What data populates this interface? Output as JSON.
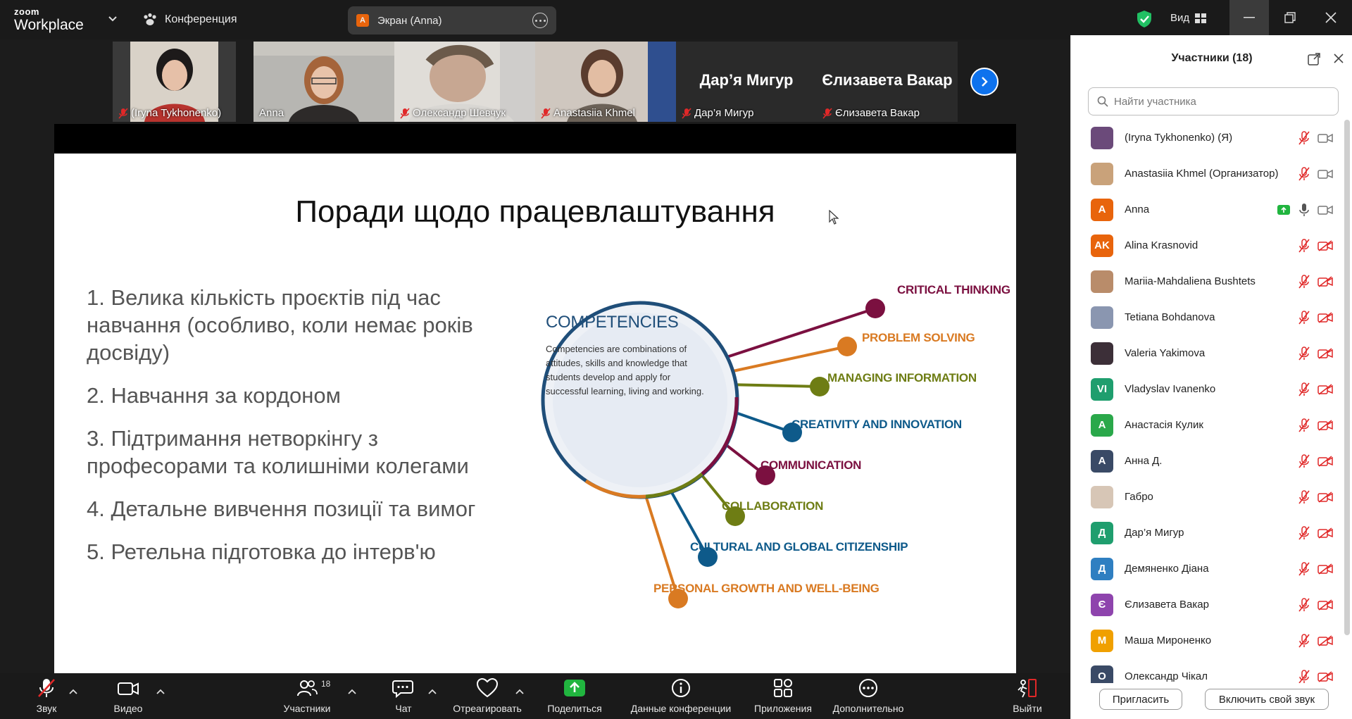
{
  "window": {
    "app_brand_top": "zoom",
    "app_brand_bottom": "Workplace",
    "conference_label": "Конференция",
    "screen_share_label": "Экран (Anna)",
    "screen_share_badge": "A",
    "view_label": "Вид"
  },
  "gallery": {
    "tiles": [
      {
        "name": "(Iryna Tykhonenko)",
        "muted": true
      },
      {
        "name": "Anna",
        "muted": false,
        "active": true
      },
      {
        "name": "Олександр Шевчук",
        "muted": true
      },
      {
        "name": "Anastasiia Khmel",
        "muted": true
      },
      {
        "name": "Дар’я Мигур",
        "muted": true,
        "big_name": "Дар’я Мигур"
      },
      {
        "name": "Єлизавета Вакар",
        "muted": true,
        "big_name": "Єлизавета Вакар"
      }
    ]
  },
  "slide": {
    "title": "Поради щодо працевлаштування",
    "tips": [
      "1. Велика кількість проєктів під час навчання (особливо, коли немає років досвіду)",
      "2. Навчання за кордоном",
      "3. Підтримання нетворкінгу з професорами та колишніми колегами",
      "4. Детальне вивчення позиції та вимог",
      "5. Ретельна підготовка до інтерв'ю"
    ],
    "diagram": {
      "center_title": "COMPETENCIES",
      "center_text": "Competencies are combinations of attitudes, skills and knowledge that students develop and apply for successful learning, living and working.",
      "branches": [
        {
          "label": "CRITICAL THINKING",
          "color": "#7b1040"
        },
        {
          "label": "PROBLEM SOLVING",
          "color": "#d97a22"
        },
        {
          "label": "MANAGING INFORMATION",
          "color": "#6e7d14"
        },
        {
          "label": "CREATIVITY AND INNOVATION",
          "color": "#0e5a8a"
        },
        {
          "label": "COMMUNICATION",
          "color": "#7b1040"
        },
        {
          "label": "COLLABORATION",
          "color": "#6e7d14"
        },
        {
          "label": "CULTURAL AND GLOBAL CITIZENSHIP",
          "color": "#0e5a8a"
        },
        {
          "label": "PERSONAL GROWTH AND WELL-BEING",
          "color": "#d97a22"
        }
      ]
    }
  },
  "participants": {
    "header": "Участники (18)",
    "search_placeholder": "Найти участника",
    "list": [
      {
        "name": "(Iryna Tykhonenko) (Я)",
        "initials": "",
        "color": "#6b4a7a"
      },
      {
        "name": "Anastasiia Khmel (Организатор)",
        "initials": "",
        "color": "#c9a27a"
      },
      {
        "name": "Anna",
        "initials": "A",
        "color": "#e8640c",
        "sharing": true,
        "mic_on": true
      },
      {
        "name": "Alina Krasnovid",
        "initials": "AK",
        "color": "#e8640c"
      },
      {
        "name": "Mariia-Mahdaliena Bushtets",
        "initials": "",
        "color": "#b98c6a"
      },
      {
        "name": "Tetiana Bohdanova",
        "initials": "",
        "color": "#8a96b0"
      },
      {
        "name": "Valeria Yakimova",
        "initials": "",
        "color": "#3c2f38"
      },
      {
        "name": "Vladyslav Ivanenko",
        "initials": "VI",
        "color": "#1f9e6e"
      },
      {
        "name": "Анастасія Кулик",
        "initials": "А",
        "color": "#2aa84a"
      },
      {
        "name": "Анна Д.",
        "initials": "А",
        "color": "#3a4a66"
      },
      {
        "name": "Габро",
        "initials": "",
        "color": "#d7c6b6"
      },
      {
        "name": "Дар’я Мигур",
        "initials": "Д",
        "color": "#1f9e6e"
      },
      {
        "name": "Демяненко Діана",
        "initials": "Д",
        "color": "#2f7fc1"
      },
      {
        "name": "Єлизавета Вакар",
        "initials": "Є",
        "color": "#8e44ad"
      },
      {
        "name": "Маша Мироненко",
        "initials": "М",
        "color": "#f0a000"
      },
      {
        "name": "Олександр Чікал",
        "initials": "О",
        "color": "#3a4a66"
      }
    ],
    "invite_label": "Пригласить",
    "unmute_label": "Включить свой звук"
  },
  "toolbar": {
    "audio": "Звук",
    "video": "Видео",
    "participants": "Участники",
    "participants_count": "18",
    "chat": "Чат",
    "react": "Отреагировать",
    "share": "Поделиться",
    "info": "Данные конференции",
    "apps": "Приложения",
    "more": "Дополнительно",
    "leave": "Выйти"
  },
  "colors": {
    "accent_blue": "#0e72ed",
    "active_green": "#21c063",
    "mute_red": "#e02828",
    "share_green": "#21b53f"
  }
}
